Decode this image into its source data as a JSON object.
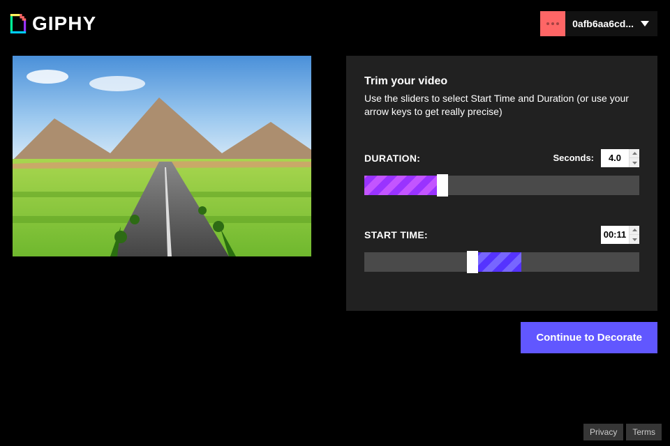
{
  "header": {
    "logo_text": "GIPHY",
    "user_label": "0afb6aa6cd..."
  },
  "panel": {
    "title": "Trim your video",
    "description": "Use the sliders to select Start Time and Duration (or use your arrow keys to get really precise)"
  },
  "duration": {
    "label": "DURATION:",
    "unit_label": "Seconds:",
    "value": "4.0"
  },
  "start_time": {
    "label": "START TIME:",
    "value": "00:11"
  },
  "cta": {
    "label": "Continue to Decorate"
  },
  "footer": {
    "privacy": "Privacy",
    "terms": "Terms"
  }
}
